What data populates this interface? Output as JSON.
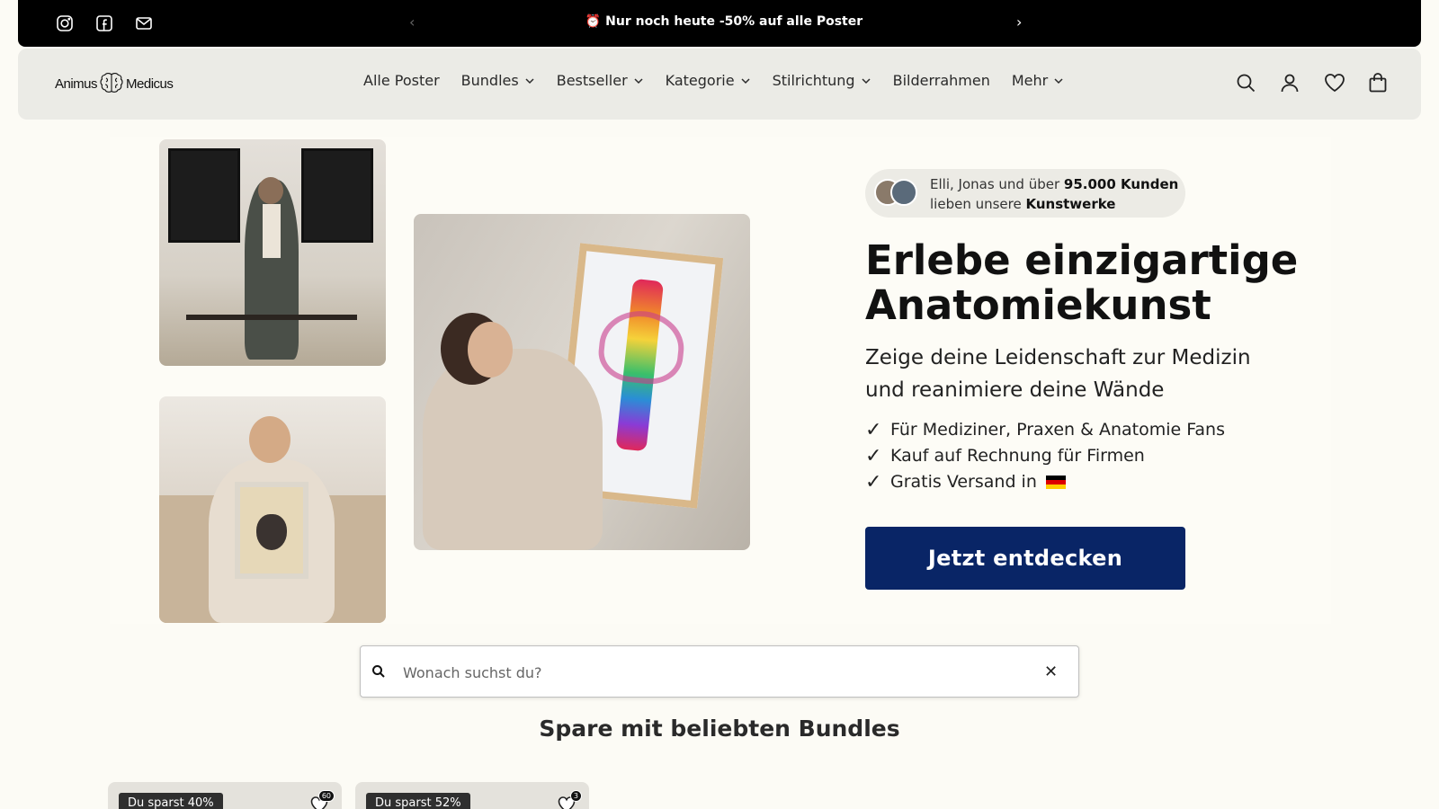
{
  "announcement": {
    "message": "⏰ Nur noch heute -50% auf alle Poster",
    "prev_arrow": "‹",
    "next_arrow": "›",
    "social_icons": [
      "instagram-icon",
      "facebook-icon",
      "mail-icon"
    ]
  },
  "header": {
    "logo_left": "Animus",
    "logo_right": "Medicus",
    "nav": [
      {
        "label": "Alle Poster",
        "dropdown": false
      },
      {
        "label": "Bundles",
        "dropdown": true
      },
      {
        "label": "Bestseller",
        "dropdown": true
      },
      {
        "label": "Kategorie",
        "dropdown": true
      },
      {
        "label": "Stilrichtung",
        "dropdown": true
      },
      {
        "label": "Bilderrahmen",
        "dropdown": false
      },
      {
        "label": "Mehr",
        "dropdown": true
      }
    ],
    "icons": [
      "search-icon",
      "account-icon",
      "wishlist-icon",
      "cart-icon"
    ]
  },
  "hero": {
    "social_proof_line1_pre": "Elli, Jonas und über ",
    "social_proof_line1_bold": "95.000 Kunden",
    "social_proof_line2_pre": "lieben unsere ",
    "social_proof_line2_bold": "Kunstwerke",
    "title_line1": "Erlebe einzigartige",
    "title_line2": "Anatomiekunst",
    "subtitle_line1": "Zeige deine Leidenschaft zur Medizin",
    "subtitle_line2": "und reanimiere deine Wände",
    "features": [
      "Für Mediziner, Praxen & Anatomie Fans",
      "Kauf auf Rechnung für Firmen",
      "Gratis Versand in"
    ],
    "check": "✓",
    "cta": "Jetzt entdecken"
  },
  "search": {
    "placeholder": "Wonach suchst du?",
    "value": "",
    "clear": "✕"
  },
  "bundles": {
    "title": "Spare mit beliebten Bundles",
    "cards": [
      {
        "badge": "Du sparst 40%",
        "count": "60"
      },
      {
        "badge": "Du sparst 52%",
        "count": "3"
      }
    ]
  },
  "colors": {
    "accent": "#092566",
    "background": "#fcfbf5",
    "header_bg": "#ebebe6",
    "announce_bg": "#000000"
  }
}
